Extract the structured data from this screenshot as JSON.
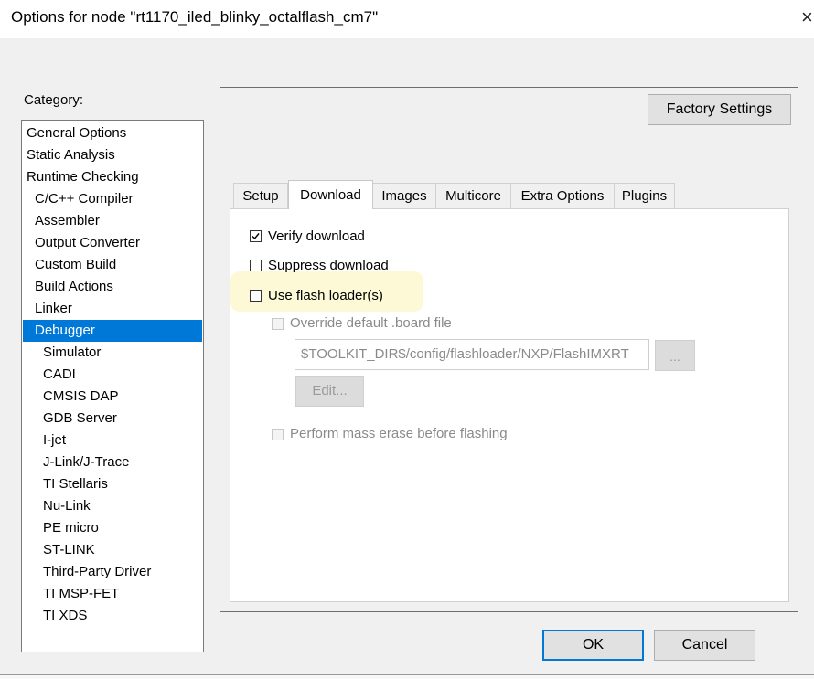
{
  "window": {
    "title": "Options for node \"rt1170_iled_blinky_octalflash_cm7\"",
    "close_glyph": "×"
  },
  "category": {
    "label": "Category:",
    "items": [
      {
        "label": "General Options",
        "level": 0
      },
      {
        "label": "Static Analysis",
        "level": 0
      },
      {
        "label": "Runtime Checking",
        "level": 0
      },
      {
        "label": "C/C++ Compiler",
        "level": 1
      },
      {
        "label": "Assembler",
        "level": 1
      },
      {
        "label": "Output Converter",
        "level": 1
      },
      {
        "label": "Custom Build",
        "level": 1
      },
      {
        "label": "Build Actions",
        "level": 1
      },
      {
        "label": "Linker",
        "level": 1
      },
      {
        "label": "Debugger",
        "level": 1,
        "selected": true
      },
      {
        "label": "Simulator",
        "level": 2
      },
      {
        "label": "CADI",
        "level": 2
      },
      {
        "label": "CMSIS DAP",
        "level": 2
      },
      {
        "label": "GDB Server",
        "level": 2
      },
      {
        "label": "I-jet",
        "level": 2
      },
      {
        "label": "J-Link/J-Trace",
        "level": 2
      },
      {
        "label": "TI Stellaris",
        "level": 2
      },
      {
        "label": "Nu-Link",
        "level": 2
      },
      {
        "label": "PE micro",
        "level": 2
      },
      {
        "label": "ST-LINK",
        "level": 2
      },
      {
        "label": "Third-Party Driver",
        "level": 2
      },
      {
        "label": "TI MSP-FET",
        "level": 2
      },
      {
        "label": "TI XDS",
        "level": 2
      }
    ]
  },
  "factory_settings_label": "Factory Settings",
  "tabs": [
    {
      "label": "Setup"
    },
    {
      "label": "Download",
      "active": true
    },
    {
      "label": "Images"
    },
    {
      "label": "Multicore"
    },
    {
      "label": "Extra Options"
    },
    {
      "label": "Plugins"
    }
  ],
  "download": {
    "verify_download": {
      "label": "Verify download",
      "checked": true
    },
    "suppress_download": {
      "label": "Suppress download",
      "checked": false
    },
    "use_flash_loader": {
      "label": "Use flash loader(s)",
      "checked": false
    },
    "override_board_file": {
      "label": "Override default .board file",
      "checked": false,
      "disabled": true
    },
    "board_file_path": "$TOOLKIT_DIR$/config/flashloader/NXP/FlashIMXRT",
    "browse_label": "...",
    "edit_label": "Edit...",
    "mass_erase": {
      "label": "Perform mass erase before flashing",
      "checked": false,
      "disabled": true
    }
  },
  "buttons": {
    "ok": "OK",
    "cancel": "Cancel"
  },
  "colors": {
    "selection": "#0078d7",
    "highlight": "#fdf9d6"
  }
}
